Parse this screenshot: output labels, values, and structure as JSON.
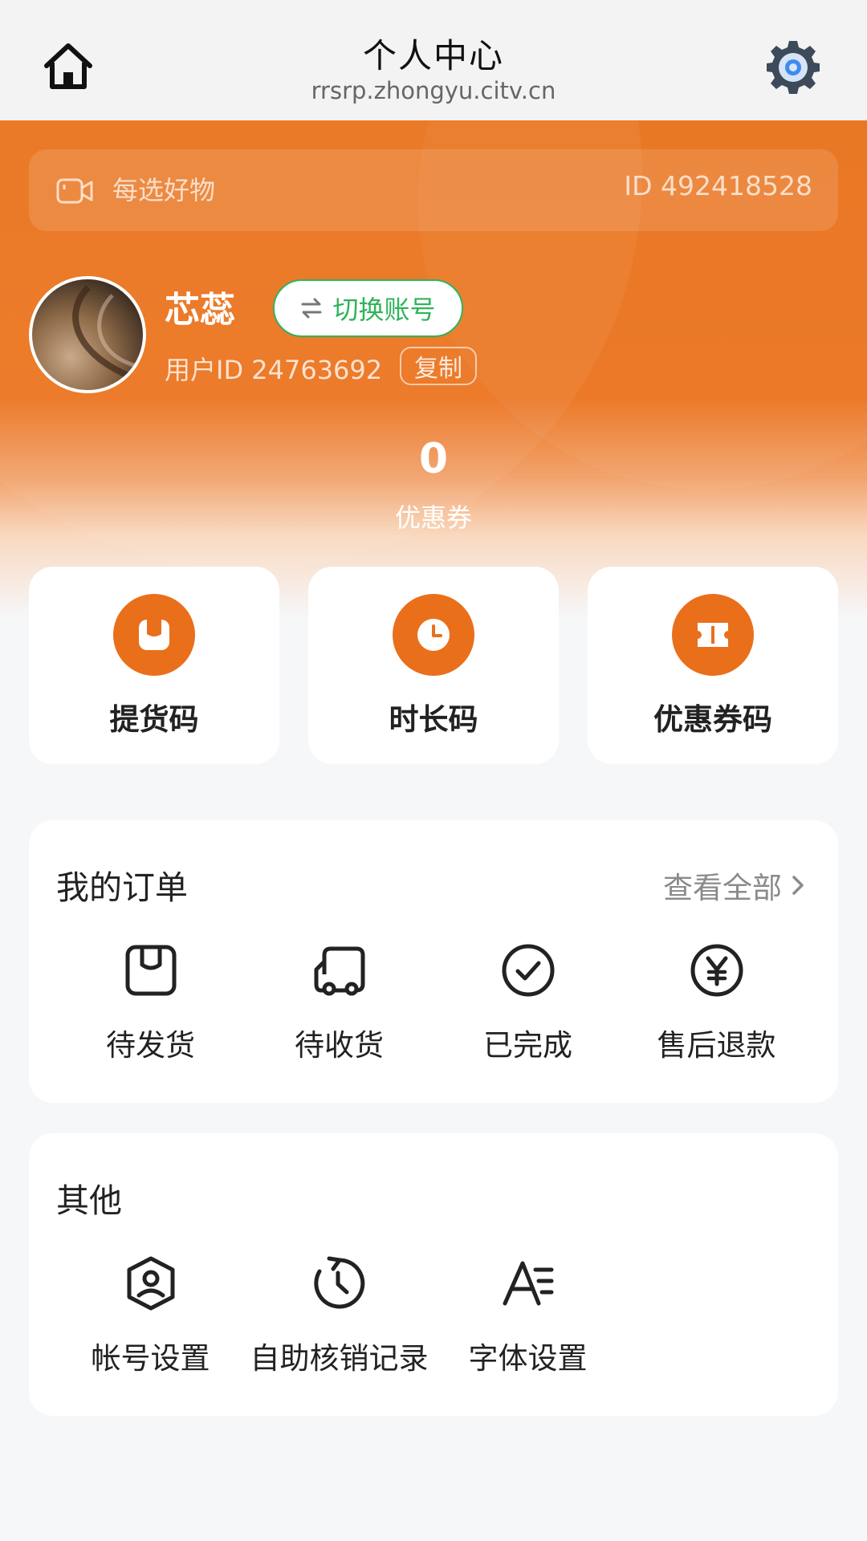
{
  "header": {
    "title": "个人中心",
    "url": "rrsrp.zhongyu.citv.cn",
    "home_icon": "home-icon",
    "settings_icon": "gear-icon"
  },
  "store": {
    "name": "每选好物",
    "id_text": "ID 492418528",
    "icon": "video-icon"
  },
  "user": {
    "name": "芯蕊",
    "switch_label": "切换账号",
    "id_text": "用户ID 24763692",
    "copy_label": "复制"
  },
  "coupons": {
    "count": "0",
    "label": "优惠券"
  },
  "quick_actions": [
    {
      "label": "提货码",
      "icon": "box-icon"
    },
    {
      "label": "时长码",
      "icon": "clock-icon"
    },
    {
      "label": "优惠券码",
      "icon": "ticket-icon"
    }
  ],
  "orders": {
    "title": "我的订单",
    "view_all": "查看全部",
    "items": [
      {
        "label": "待发货",
        "icon": "package-icon"
      },
      {
        "label": "待收货",
        "icon": "truck-icon"
      },
      {
        "label": "已完成",
        "icon": "check-circle-icon"
      },
      {
        "label": "售后退款",
        "icon": "yuan-icon"
      }
    ]
  },
  "others": {
    "title": "其他",
    "items": [
      {
        "label": "帐号设置",
        "icon": "account-shield-icon"
      },
      {
        "label": "自助核销记录",
        "icon": "history-icon"
      },
      {
        "label": "字体设置",
        "icon": "font-icon"
      }
    ]
  },
  "colors": {
    "accent": "#EA6F1B",
    "switch_green": "#2FB35A",
    "background": "#F6F7F9"
  }
}
